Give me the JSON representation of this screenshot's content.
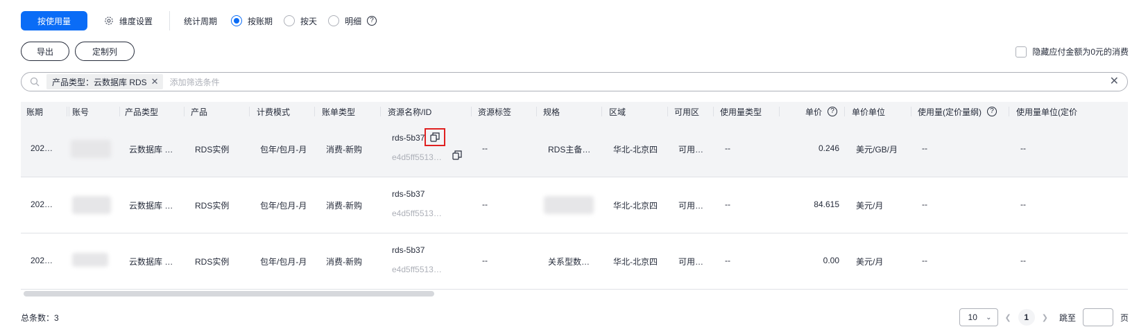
{
  "toolbar": {
    "by_usage": "按使用量",
    "dim_setting": "维度设置",
    "period_label": "统计周期",
    "radios": [
      {
        "label": "按账期",
        "checked": true
      },
      {
        "label": "按天",
        "checked": false
      },
      {
        "label": "明细",
        "checked": false
      }
    ]
  },
  "actions": {
    "export": "导出",
    "custom_columns": "定制列",
    "hide_zero": "隐藏应付金额为0元的消费"
  },
  "filter": {
    "chip": "产品类型：云数据库 RDS",
    "placeholder": "添加筛选条件"
  },
  "table": {
    "headers": [
      "账期",
      "账号",
      "产品类型",
      "产品",
      "计费模式",
      "账单类型",
      "资源名称/ID",
      "资源标签",
      "规格",
      "区域",
      "可用区",
      "使用量类型",
      "单价",
      "单价单位",
      "使用量(定价量纲)",
      "使用量单位(定价"
    ],
    "rows": [
      {
        "period": "202…",
        "product_type": "云数据库 …",
        "product": "RDS实例",
        "billing": "包年/包月-月",
        "bill_type": "消费-新购",
        "res_name": "rds-5b37",
        "res_id": "e4d5ff5513b…",
        "tag": "--",
        "spec": "RDS主备…",
        "region": "华北-北京四",
        "az": "可用…",
        "usage_type": "--",
        "price": "0.246",
        "price_unit": "美元/GB/月",
        "usage": "--",
        "usage_unit": "--"
      },
      {
        "period": "202…",
        "product_type": "云数据库 …",
        "product": "RDS实例",
        "billing": "包年/包月-月",
        "bill_type": "消费-新购",
        "res_name": "rds-5b37",
        "res_id": "e4d5ff5513b…",
        "tag": "--",
        "spec": "",
        "region": "华北-北京四",
        "az": "可用…",
        "usage_type": "--",
        "price": "84.615",
        "price_unit": "美元/月",
        "usage": "--",
        "usage_unit": "--"
      },
      {
        "period": "202…",
        "product_type": "云数据库 …",
        "product": "RDS实例",
        "billing": "包年/包月-月",
        "bill_type": "消费-新购",
        "res_name": "rds-5b37",
        "res_id": "e4d5ff5513b…",
        "tag": "--",
        "spec": "关系型数…",
        "region": "华北-北京四",
        "az": "可用…",
        "usage_type": "--",
        "price": "0.00",
        "price_unit": "美元/月",
        "usage": "--",
        "usage_unit": "--"
      }
    ]
  },
  "footer": {
    "total": "总条数：3",
    "page_size": "10",
    "current_page": "1",
    "jump_label": "跳至",
    "page_unit": "页"
  },
  "colors": {
    "primary": "#0a6cf6",
    "highlight_border": "#e02020"
  }
}
